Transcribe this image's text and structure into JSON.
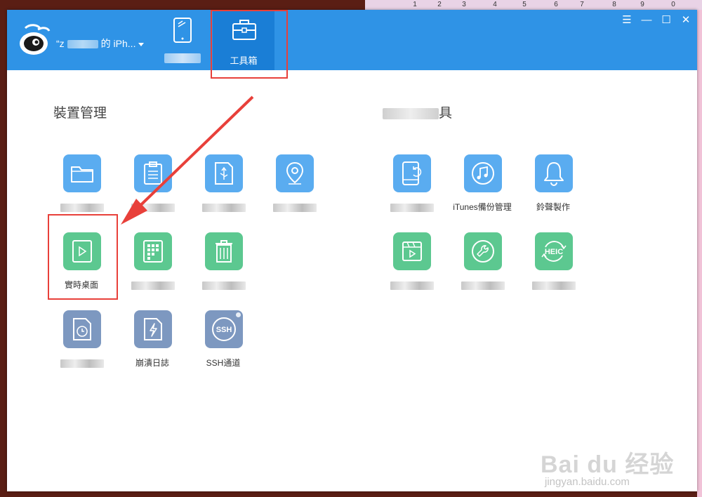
{
  "bg_strip": {
    "cells": [
      "1",
      "2",
      "3",
      "4",
      "5",
      "6",
      "7",
      "8",
      "9",
      "0"
    ]
  },
  "app": {
    "device_name_prefix": "“z",
    "device_name_suffix": "的 iPh..."
  },
  "tabs": [
    {
      "id": "device",
      "label": "",
      "icon": "tablet-icon"
    },
    {
      "id": "toolbox",
      "label": "工具箱",
      "icon": "toolbox-icon"
    }
  ],
  "window_controls": [
    "menu-icon",
    "minimize-icon",
    "maximize-icon",
    "close-icon"
  ],
  "sections": {
    "left_title": "裝置管理",
    "right_title": "具"
  },
  "tools_left": [
    {
      "name": "folder",
      "label": "",
      "color": "#5aacf0",
      "icon": "folder-icon"
    },
    {
      "name": "clipboard",
      "label": "",
      "color": "#5aacf0",
      "icon": "clipboard-icon"
    },
    {
      "name": "usb-drive",
      "label": "",
      "color": "#5aacf0",
      "icon": "usb-drive-icon"
    },
    {
      "name": "location",
      "label": "",
      "color": "#5aacf0",
      "icon": "location-pin-icon"
    },
    {
      "name": "realtime-desktop",
      "label": "實時桌面",
      "color": "#5cc890",
      "icon": "play-screen-icon"
    },
    {
      "name": "apps-grid",
      "label": "",
      "color": "#5cc890",
      "icon": "grid-icon"
    },
    {
      "name": "trash",
      "label": "",
      "color": "#5cc890",
      "icon": "trash-icon"
    },
    {
      "name": "log-clock",
      "label": "",
      "color": "#7d98c0",
      "icon": "clock-file-icon"
    },
    {
      "name": "flash-file",
      "label": "崩潰日誌",
      "color": "#7d98c0",
      "icon": "lightning-file-icon"
    },
    {
      "name": "ssh",
      "label": "SSH通道",
      "color": "#7d98c0",
      "icon": "ssh-icon",
      "icon_text": "SSH"
    }
  ],
  "tools_right": [
    {
      "name": "phone-sync",
      "label": "",
      "color": "#5aacf0",
      "icon": "phone-sync-icon"
    },
    {
      "name": "itunes-backup",
      "label": "iTunes備份管理",
      "color": "#5aacf0",
      "icon": "music-sync-icon"
    },
    {
      "name": "ringtone",
      "label": "鈴聲製作",
      "color": "#5aacf0",
      "icon": "bell-icon"
    },
    {
      "name": "video",
      "label": "",
      "color": "#5cc890",
      "icon": "video-icon"
    },
    {
      "name": "repair",
      "label": "",
      "color": "#5cc890",
      "icon": "wrench-icon"
    },
    {
      "name": "heic",
      "label": "",
      "color": "#5cc890",
      "icon": "heic-icon",
      "icon_text": "HEIC"
    }
  ],
  "watermark": {
    "main": "Bai du 经验",
    "sub": "jingyan.baidu.com"
  }
}
